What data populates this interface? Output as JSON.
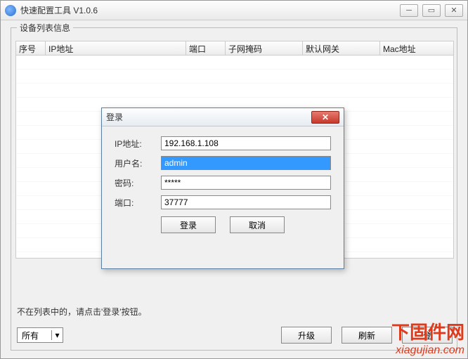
{
  "window": {
    "title": "快速配置工具 V1.0.6"
  },
  "groupbox": {
    "label": "设备列表信息"
  },
  "table": {
    "headers": [
      "序号",
      "IP地址",
      "端口",
      "子网掩码",
      "默认网关",
      "Mac地址"
    ]
  },
  "hint": "不在列表中的，请点击'登录'按钮。",
  "filter": {
    "selected": "所有"
  },
  "buttons": {
    "upgrade": "升级",
    "refresh": "刷新",
    "login_trunc": "登"
  },
  "dialog": {
    "title": "登录",
    "labels": {
      "ip": "IP地址:",
      "user": "用户名:",
      "password": "密码:",
      "port": "端口:"
    },
    "values": {
      "ip": "192.168.1.108",
      "user": "admin",
      "password": "*****",
      "port": "37777"
    },
    "btn_login": "登录",
    "btn_cancel": "取消"
  },
  "watermark": {
    "cn": "下固件网",
    "en": "xiagujian.com"
  }
}
